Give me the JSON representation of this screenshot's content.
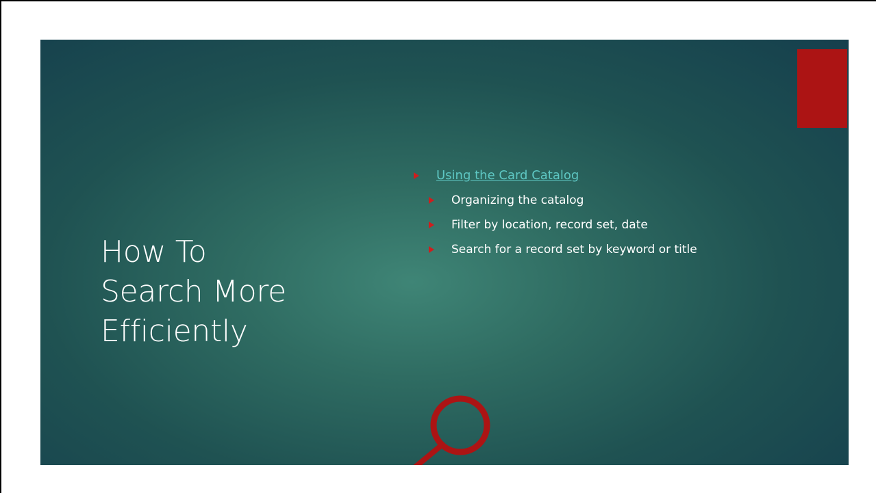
{
  "slide": {
    "title_lines": [
      "How To",
      "Search More",
      "Efficiently"
    ],
    "bullets": {
      "main_link": "Using the Card Catalog",
      "sub_items": [
        "Organizing the catalog",
        "Filter by location, record set, date",
        "Search for a record set by keyword or title"
      ]
    },
    "icons": {
      "bullet": "triangle-bullet-icon",
      "graphic": "magnifying-glass-icon"
    },
    "colors": {
      "background": "#2f6c62",
      "accent": "#ac1414",
      "bullet": "#d01d1d",
      "link": "#5ec7c3",
      "text": "#ffffff"
    }
  }
}
